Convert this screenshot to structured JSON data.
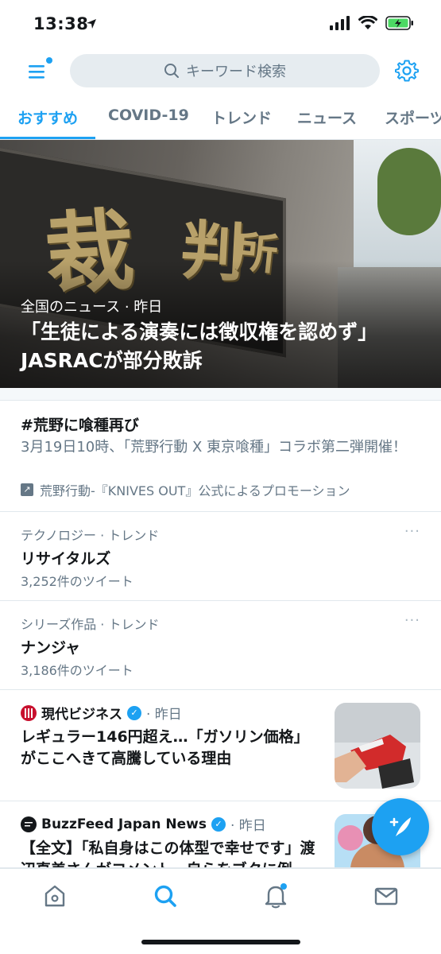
{
  "status_bar": {
    "time": "13:38"
  },
  "header": {
    "search_placeholder": "キーワード検索"
  },
  "tabs": [
    {
      "label": "おすすめ"
    },
    {
      "label": "COVID-19"
    },
    {
      "label": "トレンド"
    },
    {
      "label": "ニュース"
    },
    {
      "label": "スポーツ"
    }
  ],
  "hero": {
    "meta": "全国のニュース · 昨日",
    "title": "「生徒による演奏には徴収権を認めず」JASRACが部分敗訴",
    "sign_chars": [
      "裁",
      "判",
      "所"
    ]
  },
  "promo": {
    "title": "#荒野に喰種再び",
    "description": "3月19日10時、「荒野行動 X 東京喰種」コラボ第二弾開催！",
    "promoted_by": "荒野行動-『KNIVES OUT』公式によるプロモーション"
  },
  "trends": [
    {
      "category": "テクノロジー · トレンド",
      "name": "リサイタルズ",
      "count": "3,252件のツイート",
      "more": "···"
    },
    {
      "category": "シリーズ作品 · トレンド",
      "name": "ナンジャ",
      "count": "3,186件のツイート",
      "more": "···"
    }
  ],
  "news": [
    {
      "source": "現代ビジネス",
      "time": "· 昨日",
      "title": "レギュラー146円超え…「ガソリン価格」がここへきて高騰している理由"
    },
    {
      "source": "BuzzFeed Japan News",
      "time": "· 昨日",
      "title": "【全文】「私自身はこの体型で幸せです」渡辺直美さんがコメント。自らをブタに例"
    }
  ],
  "colors": {
    "accent": "#1da1f2",
    "text": "#14171a",
    "secondary": "#657786",
    "divider": "#e1e8ed"
  },
  "icons": [
    "menu-icon",
    "search-icon",
    "gear-icon",
    "home-icon",
    "bell-icon",
    "mail-icon",
    "compose-icon",
    "verified-icon",
    "promoted-icon"
  ]
}
